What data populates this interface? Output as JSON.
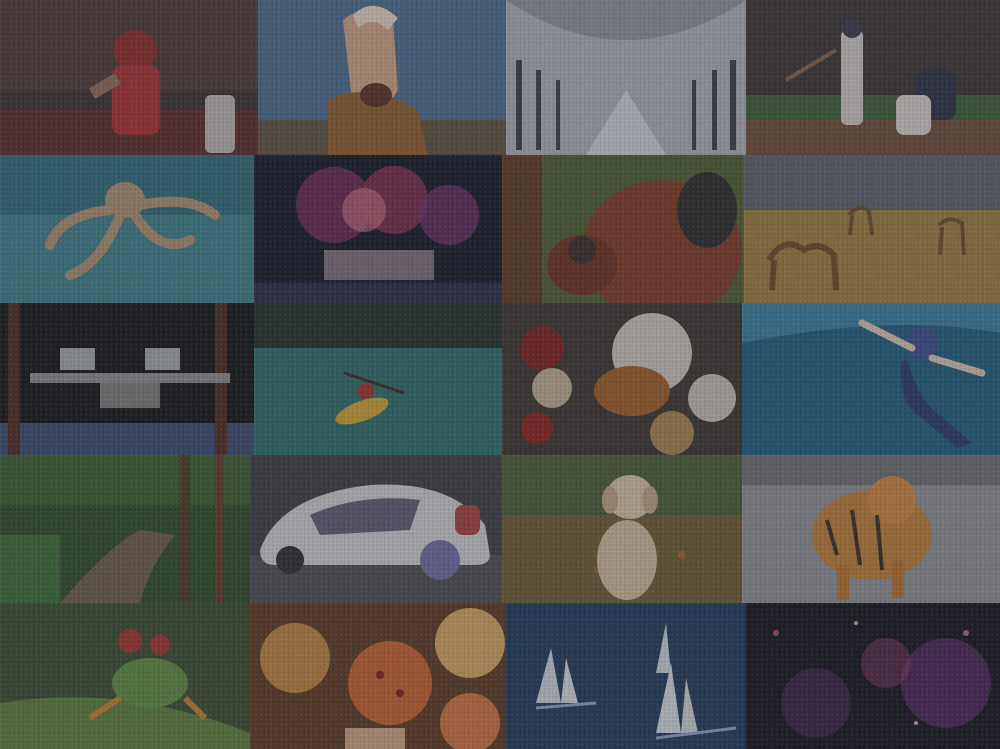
{
  "image": {
    "layout": "photo-mosaic",
    "rows": 5,
    "columns": 4,
    "tiles": [
      {
        "subject": "football-player"
      },
      {
        "subject": "horse"
      },
      {
        "subject": "snowy-tree-avenue"
      },
      {
        "subject": "baseball-batter"
      },
      {
        "subject": "octopus"
      },
      {
        "subject": "fireworks"
      },
      {
        "subject": "orangutan"
      },
      {
        "subject": "camels-desert"
      },
      {
        "subject": "space-station"
      },
      {
        "subject": "kayak"
      },
      {
        "subject": "dinner-table"
      },
      {
        "subject": "swimmer"
      },
      {
        "subject": "forest-boardwalk"
      },
      {
        "subject": "concept-car"
      },
      {
        "subject": "puppy"
      },
      {
        "subject": "tiger-snow"
      },
      {
        "subject": "tree-frog"
      },
      {
        "subject": "pizza-table"
      },
      {
        "subject": "sailboats"
      },
      {
        "subject": "galaxy"
      }
    ]
  }
}
